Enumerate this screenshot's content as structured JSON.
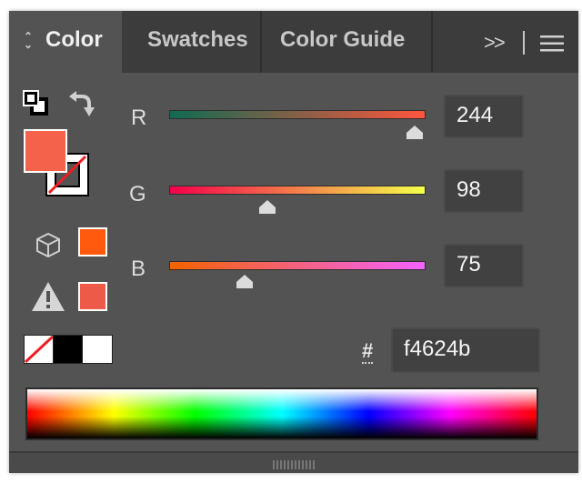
{
  "tabs": [
    {
      "label": "Color",
      "active": true
    },
    {
      "label": "Swatches",
      "active": false
    },
    {
      "label": "Color Guide",
      "active": false
    }
  ],
  "tab_menu": {
    "overflow_symbol": ">>",
    "menu_icon": "hamburger-menu-icon"
  },
  "channels": [
    {
      "label": "R",
      "value": "244",
      "fraction": 0.957
    },
    {
      "label": "G",
      "value": "98",
      "fraction": 0.384
    },
    {
      "label": "B",
      "value": "75",
      "fraction": 0.294
    }
  ],
  "hex": {
    "symbol": "#",
    "value": "f4624b"
  },
  "colors": {
    "fill": "#f4624b",
    "gamut_swatch": "#ff5a0e",
    "web_safe_swatch": "#ee5a48",
    "r_track_start": "#0f6a52",
    "r_track_end": "#ff553c",
    "g_track_start": "#f4004b",
    "g_track_end": "#f4ff4b",
    "b_track_start": "#f46200",
    "b_track_end": "#f462ff"
  },
  "icons": [
    "default-fill-stroke-icon",
    "swap-arrow-icon",
    "out-of-web-gamut-cube-icon",
    "out-of-gamut-warning-icon",
    "none-swatch-icon",
    "black-swatch-icon",
    "white-swatch-icon"
  ]
}
